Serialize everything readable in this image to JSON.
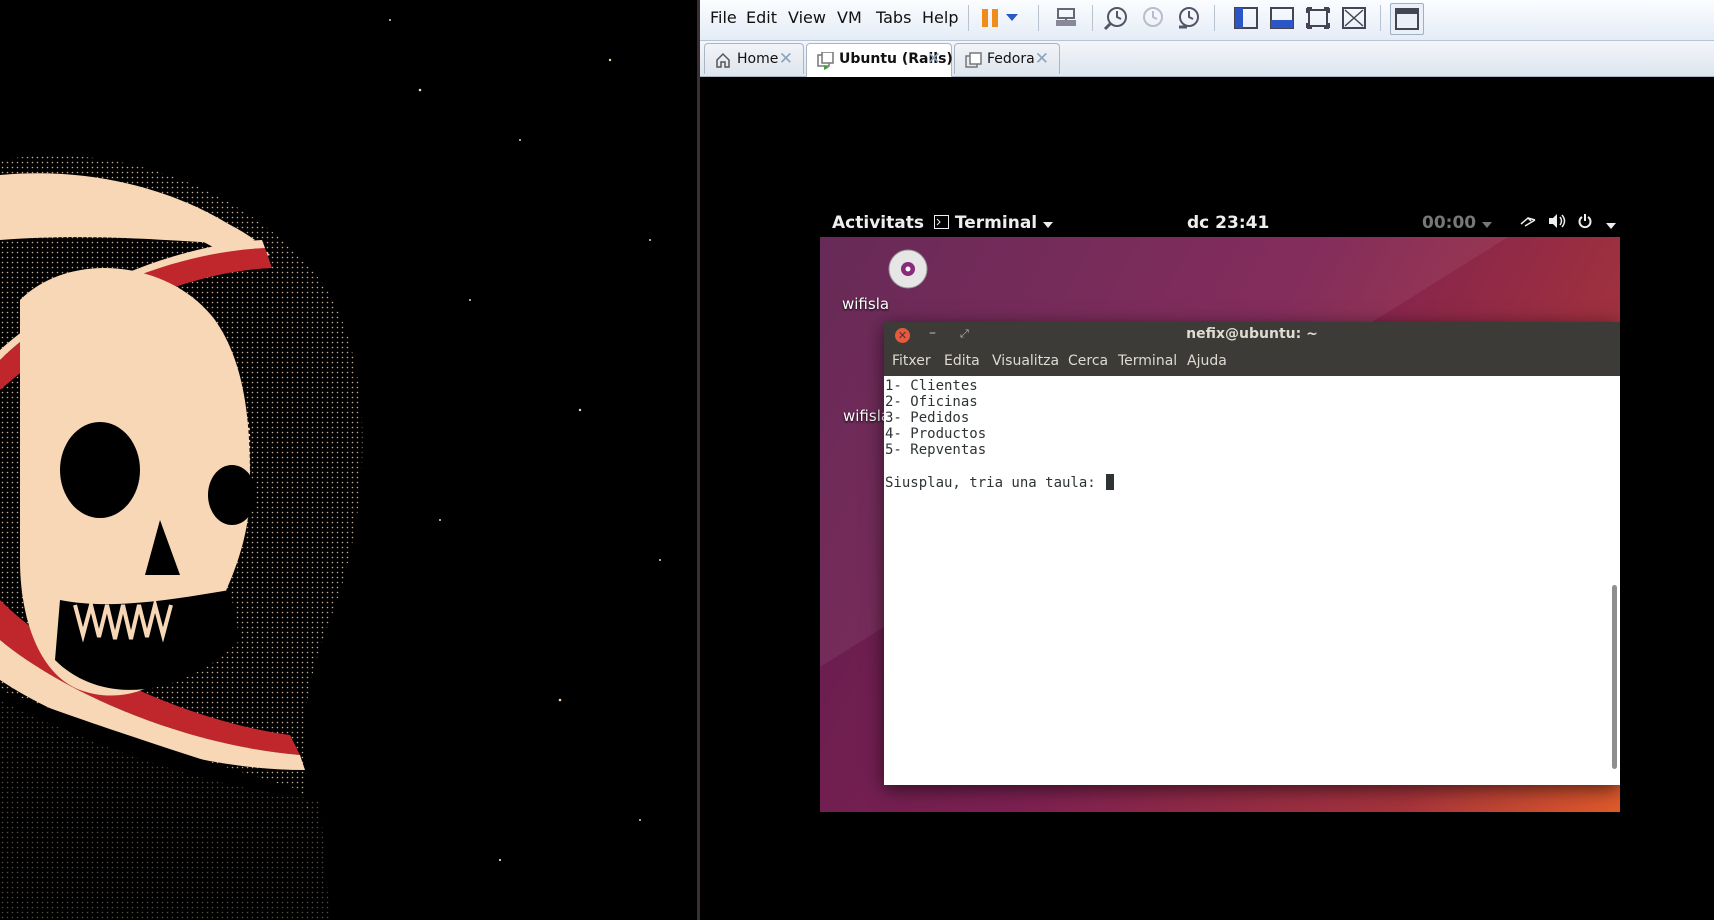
{
  "vmware": {
    "menu": [
      "File",
      "Edit",
      "View",
      "VM",
      "Tabs",
      "Help"
    ],
    "tabs": [
      {
        "label": "Home",
        "icon": "home-icon",
        "active": false
      },
      {
        "label": "Ubuntu (Rails)",
        "icon": "vm-running-icon",
        "active": true
      },
      {
        "label": "Fedora",
        "icon": "vm-icon",
        "active": false
      }
    ],
    "tab_close": "✕"
  },
  "gnome": {
    "activities": "Activitats",
    "app_menu": "Terminal",
    "clock": "dc 23:41",
    "timer": "00:00"
  },
  "desktop": {
    "icon_label_1": "wifisla",
    "icon_label_2": "wifisla"
  },
  "terminal": {
    "title": "nefix@ubuntu: ~",
    "menu": [
      "Fitxer",
      "Edita",
      "Visualitza",
      "Cerca",
      "Terminal",
      "Ajuda"
    ],
    "lines": [
      "1- Clientes",
      "2- Oficinas",
      "3- Pedidos",
      "4- Productos",
      "5- Repventas",
      "",
      "Siusplau, tria una taula: "
    ]
  },
  "colors": {
    "ubuntu_purple": "#7c2052",
    "ubuntu_orange": "#e05a2a",
    "terminal_titlebar": "#3c3b37",
    "close_button": "#e9573f"
  }
}
